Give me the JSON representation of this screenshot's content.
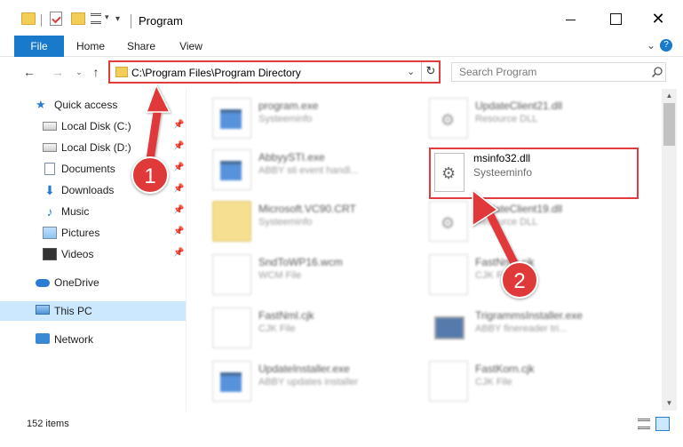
{
  "window": {
    "title": "Program",
    "minimize_label": "",
    "maximize_label": "",
    "close_label": "✕"
  },
  "ribbon": {
    "tabs": [
      "File",
      "Home",
      "Share",
      "View"
    ]
  },
  "address_bar": {
    "path": "C:\\Program Files\\Program Directory",
    "refresh_icon": "↻"
  },
  "search": {
    "placeholder": "Search Program"
  },
  "sidebar": {
    "items": [
      {
        "label": "Quick access",
        "icon": "star-icon"
      },
      {
        "label": "Local Disk (C:)",
        "icon": "drive-icon",
        "pinned": true
      },
      {
        "label": "Local Disk (D:)",
        "icon": "drive-icon",
        "pinned": true
      },
      {
        "label": "Documents",
        "icon": "documents-icon",
        "pinned": true
      },
      {
        "label": "Downloads",
        "icon": "downloads-icon",
        "pinned": true
      },
      {
        "label": "Music",
        "icon": "music-icon",
        "pinned": true
      },
      {
        "label": "Pictures",
        "icon": "pictures-icon",
        "pinned": true
      },
      {
        "label": "Videos",
        "icon": "videos-icon",
        "pinned": true
      },
      {
        "label": "OneDrive",
        "icon": "cloud-icon"
      },
      {
        "label": "This PC",
        "icon": "computer-icon",
        "selected": true
      },
      {
        "label": "Network",
        "icon": "network-icon"
      }
    ]
  },
  "files": [
    {
      "name": "program.exe",
      "type": "Systeeminfo"
    },
    {
      "name": "UpdateClient21.dll",
      "type": "Resource DLL"
    },
    {
      "name": "AbbyySTI.exe",
      "type": "ABBY sti event handl..."
    },
    {
      "name": "msinfo32.dll",
      "type": "Systeeminfo"
    },
    {
      "name": "Microsoft.VC90.CRT",
      "type": "Systeeminfo"
    },
    {
      "name": "UpdateClient19.dll",
      "type": "Resource DLL"
    },
    {
      "name": "SndToWP16.wcm",
      "type": "WCM File"
    },
    {
      "name": "FastNmb.cjk",
      "type": "CJK File"
    },
    {
      "name": "FastNml.cjk",
      "type": "CJK File"
    },
    {
      "name": "TrigrammsInstaller.exe",
      "type": "ABBY finereader tri..."
    },
    {
      "name": "UpdateInstaller.exe",
      "type": "ABBY updates installer"
    },
    {
      "name": "FastKorn.cjk",
      "type": "CJK File"
    }
  ],
  "status": {
    "item_count": "152 items"
  },
  "annotations": {
    "step1": "1",
    "step2": "2"
  },
  "colors": {
    "accent": "#1979ca",
    "highlight_red": "#e23b3b",
    "selection": "#cce8ff"
  }
}
